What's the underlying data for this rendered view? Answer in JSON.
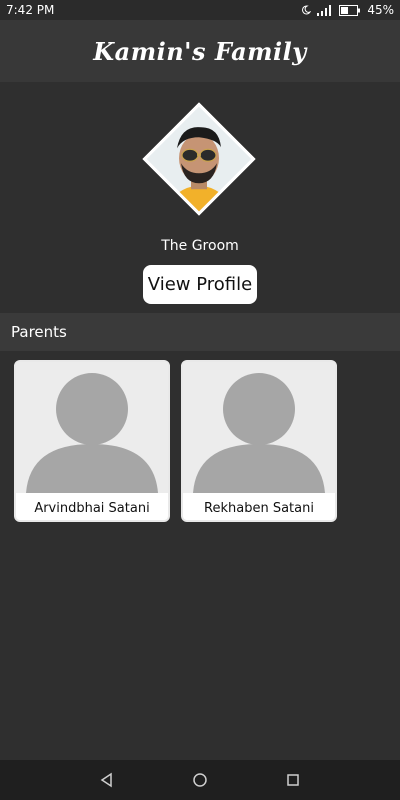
{
  "status": {
    "time": "7:42 PM",
    "battery": "45%"
  },
  "app_bar": {
    "title": "Kamin's Family"
  },
  "groom": {
    "label": "The Groom",
    "view_profile": "View Profile"
  },
  "parents": {
    "header": "Parents",
    "items": [
      {
        "name": "Arvindbhai Satani"
      },
      {
        "name": "Rekhaben Satani"
      }
    ]
  },
  "nav": {
    "back": "back-icon",
    "home": "home-icon",
    "recents": "recents-icon"
  }
}
